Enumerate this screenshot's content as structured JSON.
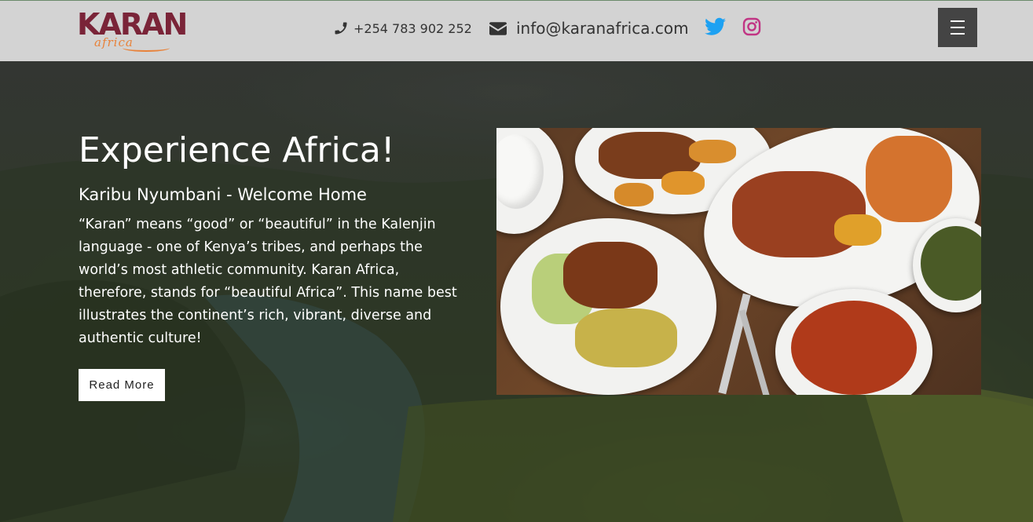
{
  "header": {
    "logo": {
      "main": "KARAN",
      "sub": "africa"
    },
    "phone": "+254 783 902 252",
    "email": "info@karanafrica.com",
    "icons": {
      "phone": "phone-icon",
      "email": "envelope-icon",
      "twitter": "twitter-icon",
      "instagram": "instagram-icon",
      "menu": "hamburger-menu-icon"
    },
    "colors": {
      "background": "#d3d3d3",
      "twitter": "#1da1f2",
      "instagram": "#c13584",
      "menu_button": "#444444"
    }
  },
  "hero": {
    "title": "Experience Africa!",
    "subtitle": "Karibu Nyumbani - Welcome Home",
    "body": "“Karan” means “good” or “beautiful” in the Kalenjin language - one of Kenya’s tribes, and perhaps the world’s most athletic community. Karan Africa, therefore, stands for “beautiful Africa”. This name best illustrates the continent’s rich, vibrant, diverse and authentic culture!",
    "button_label": "Read More"
  },
  "brand_colors": {
    "logo_main": "#7a2438",
    "logo_accent": "#e8823a"
  }
}
